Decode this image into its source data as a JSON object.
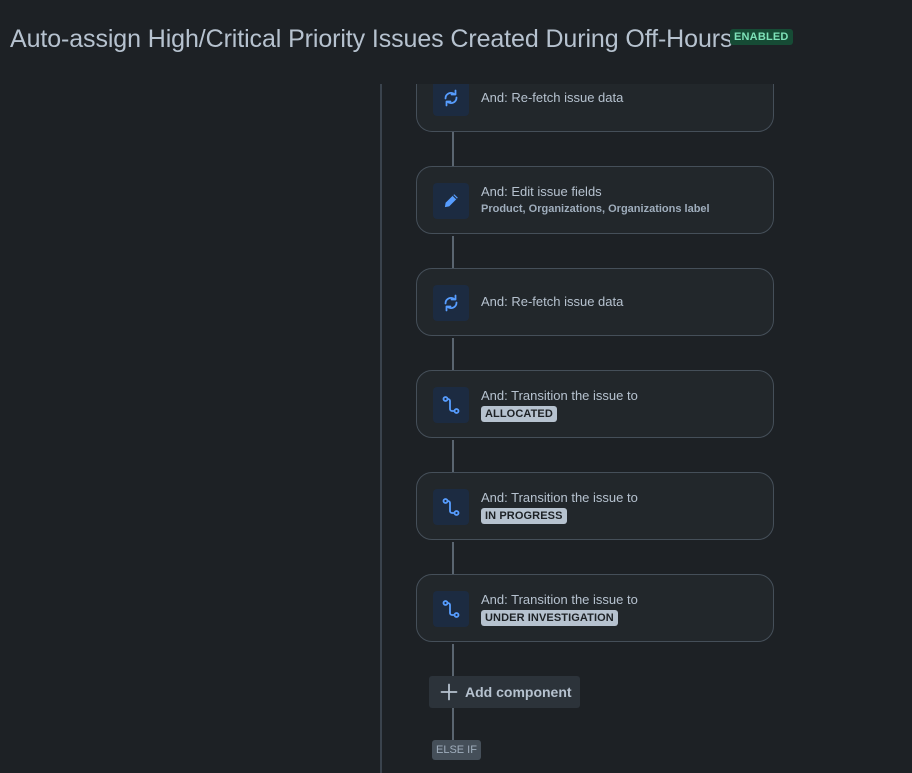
{
  "header": {
    "title": "Auto-assign High/Critical Priority Issues Created During Off-Hours",
    "status": "ENABLED"
  },
  "components": [
    {
      "icon": "refresh-icon",
      "title": "And: Re-fetch issue data"
    },
    {
      "icon": "pencil-icon",
      "title": "And: Edit issue fields",
      "detail": "Product, Organizations, Organizations label"
    },
    {
      "icon": "refresh-icon",
      "title": "And: Re-fetch issue data"
    },
    {
      "icon": "transition-icon",
      "title": "And: Transition the issue to",
      "status": "ALLOCATED"
    },
    {
      "icon": "transition-icon",
      "title": "And: Transition the issue to",
      "status": "IN PROGRESS"
    },
    {
      "icon": "transition-icon",
      "title": "And: Transition the issue to",
      "status": "UNDER INVESTIGATION"
    }
  ],
  "add_component": {
    "label": "Add component",
    "icon": "plus-icon"
  },
  "branch": {
    "label": "ELSE IF"
  },
  "colors": {
    "background": "#1d2125",
    "card": "#22272b",
    "icon_accent": "#579dff",
    "enabled_badge": "#164b35"
  }
}
